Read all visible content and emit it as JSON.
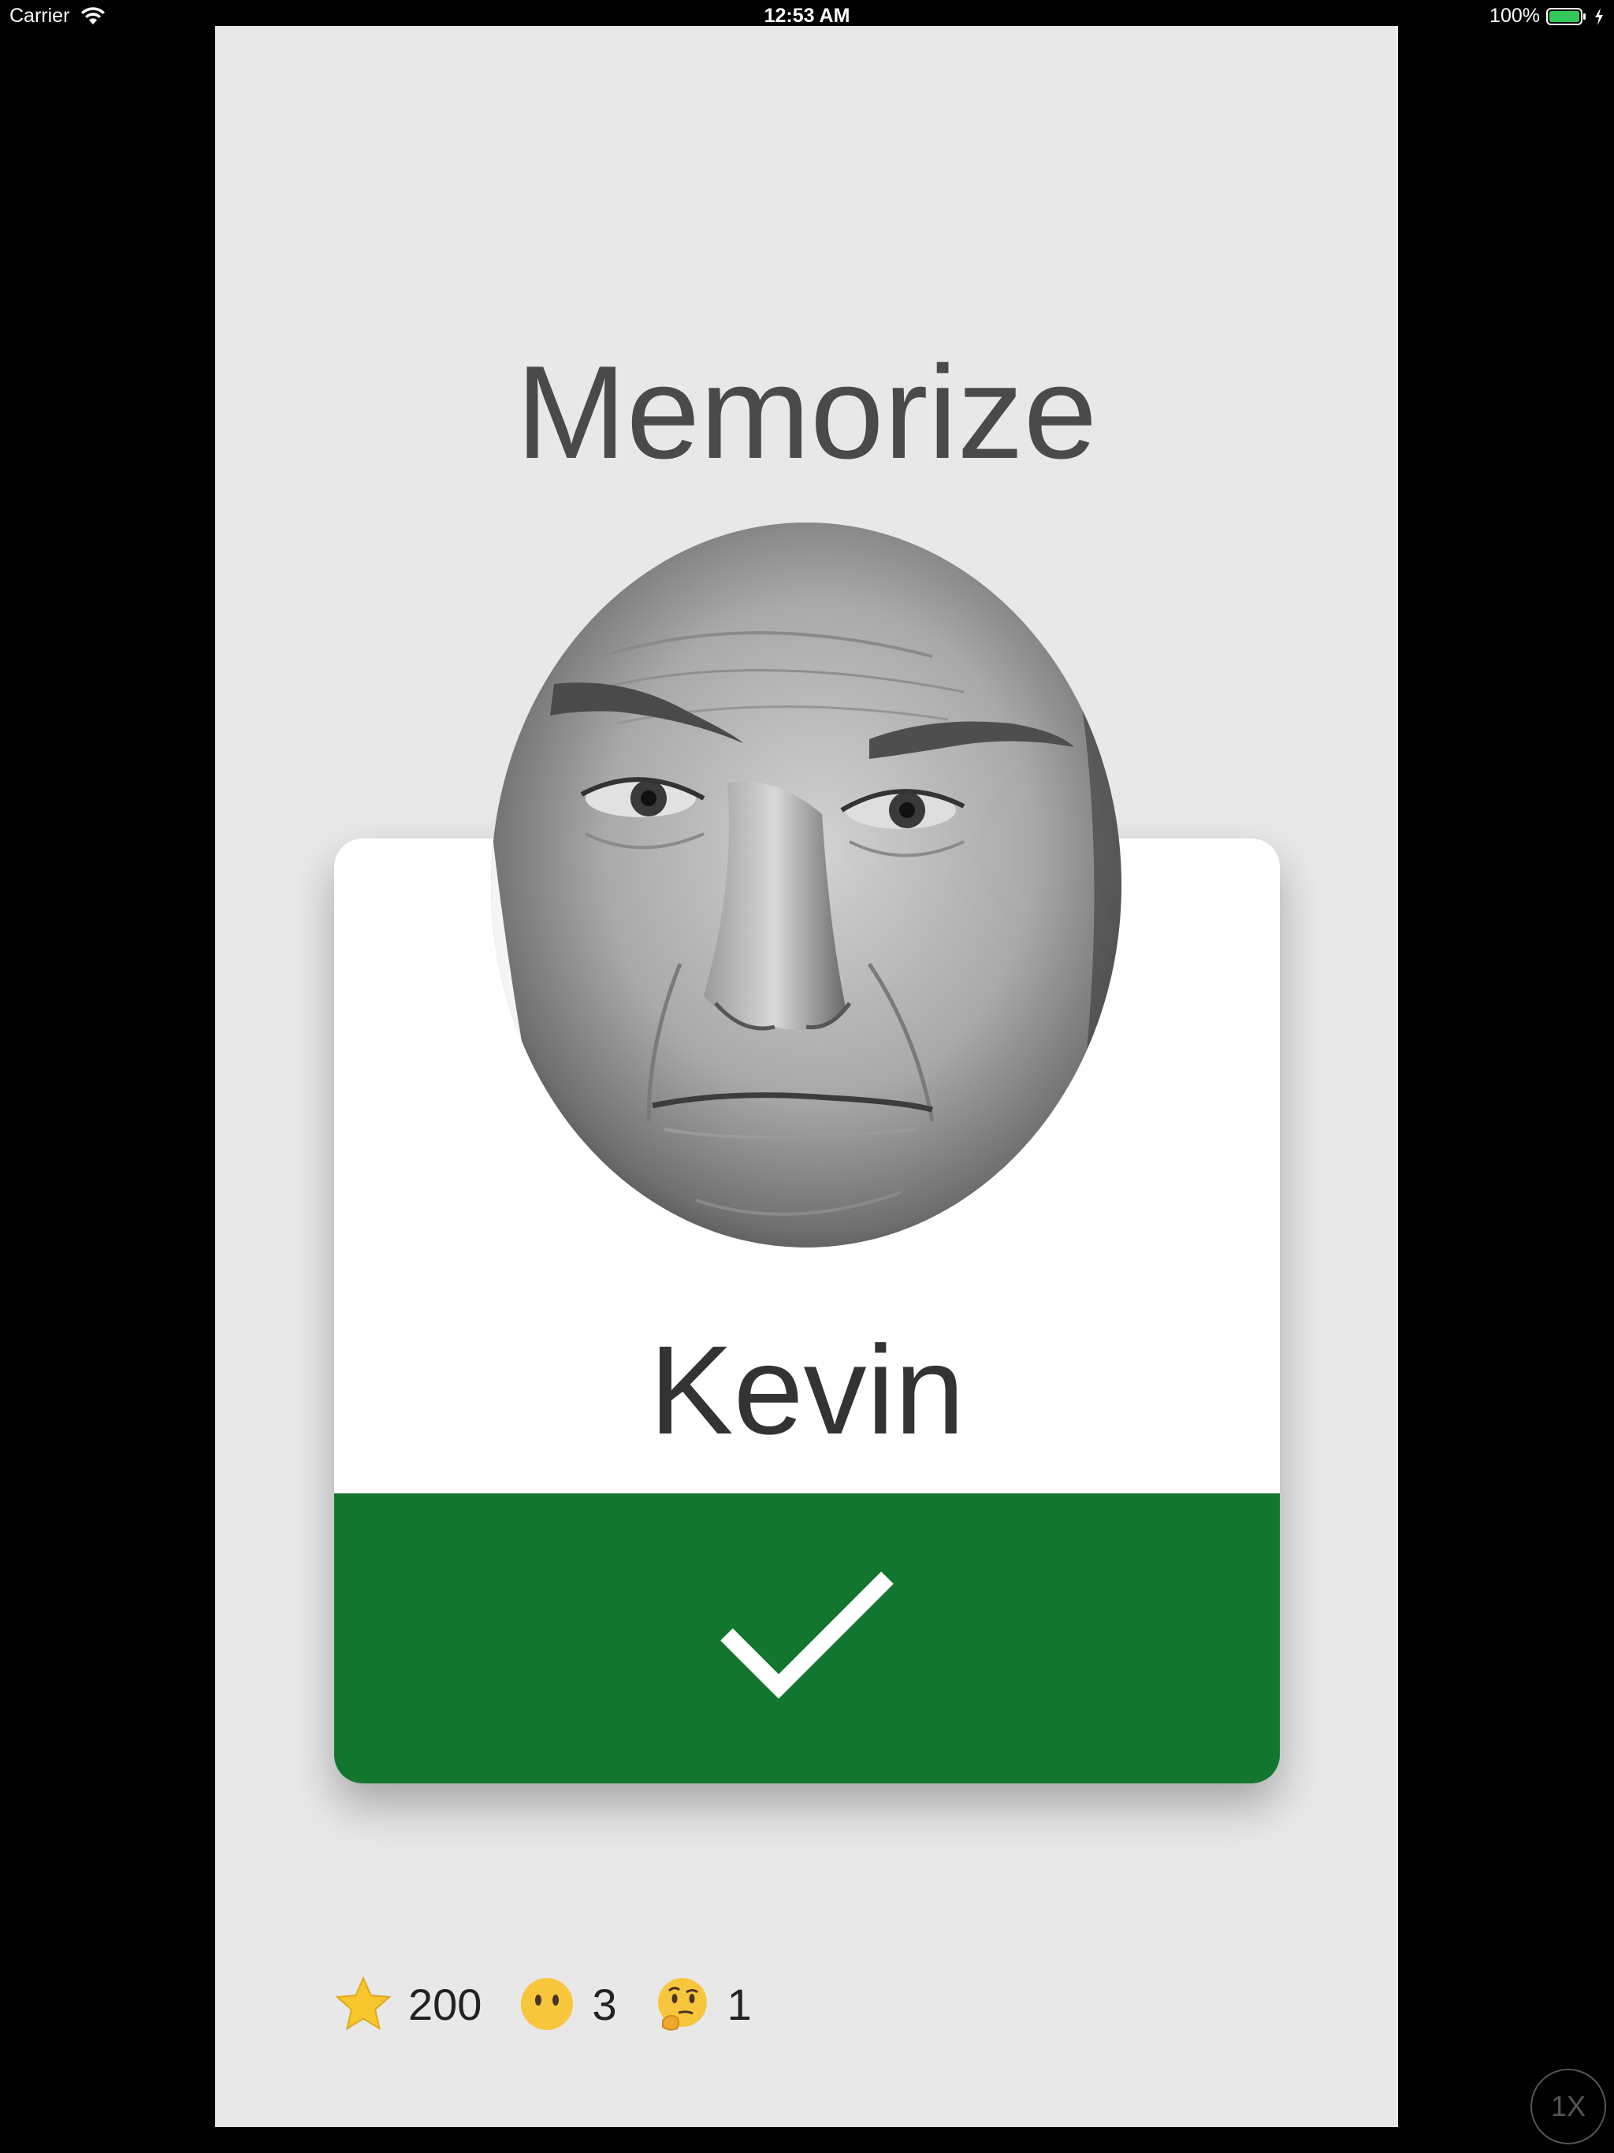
{
  "status_bar": {
    "carrier": "Carrier",
    "time": "12:53 AM",
    "battery_percent": "100%",
    "battery_level": 1.0,
    "battery_color": "#34c759"
  },
  "app": {
    "title": "Memorize"
  },
  "card": {
    "name": "Kevin",
    "answer_color": "#12762e",
    "answer_icon": "checkmark-icon"
  },
  "stats": [
    {
      "icon": "star-icon",
      "value": "200"
    },
    {
      "icon": "neutral-face-icon",
      "value": "3"
    },
    {
      "icon": "thinking-face-icon",
      "value": "1"
    }
  ],
  "zoom": {
    "label": "1X"
  }
}
